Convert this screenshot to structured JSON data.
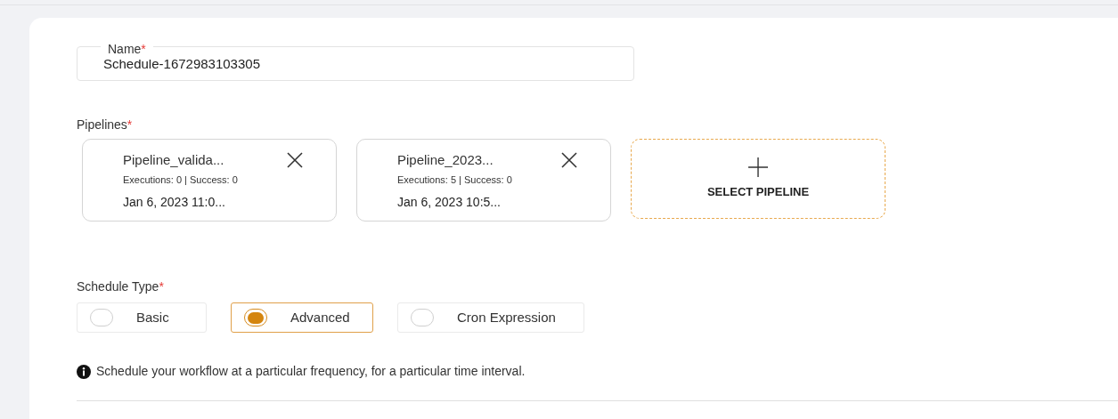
{
  "name_field": {
    "label": "Name",
    "required_mark": "*",
    "value": "Schedule-1672983103305"
  },
  "pipelines": {
    "label": "Pipelines",
    "required_mark": "*",
    "items": [
      {
        "name": "Pipeline_valida...",
        "stats": "Executions: 0 | Success: 0",
        "date": "Jan 6, 2023 11:0..."
      },
      {
        "name": "Pipeline_2023...",
        "stats": "Executions: 5 | Success: 0",
        "date": "Jan 6, 2023 10:5..."
      }
    ],
    "select_button": "SELECT PIPELINE"
  },
  "schedule_type": {
    "label": "Schedule Type",
    "required_mark": "*",
    "options": [
      {
        "label": "Basic",
        "selected": false
      },
      {
        "label": "Advanced",
        "selected": true
      },
      {
        "label": "Cron Expression",
        "selected": false
      }
    ]
  },
  "info": "Schedule your workflow at a particular frequency, for a particular time interval."
}
